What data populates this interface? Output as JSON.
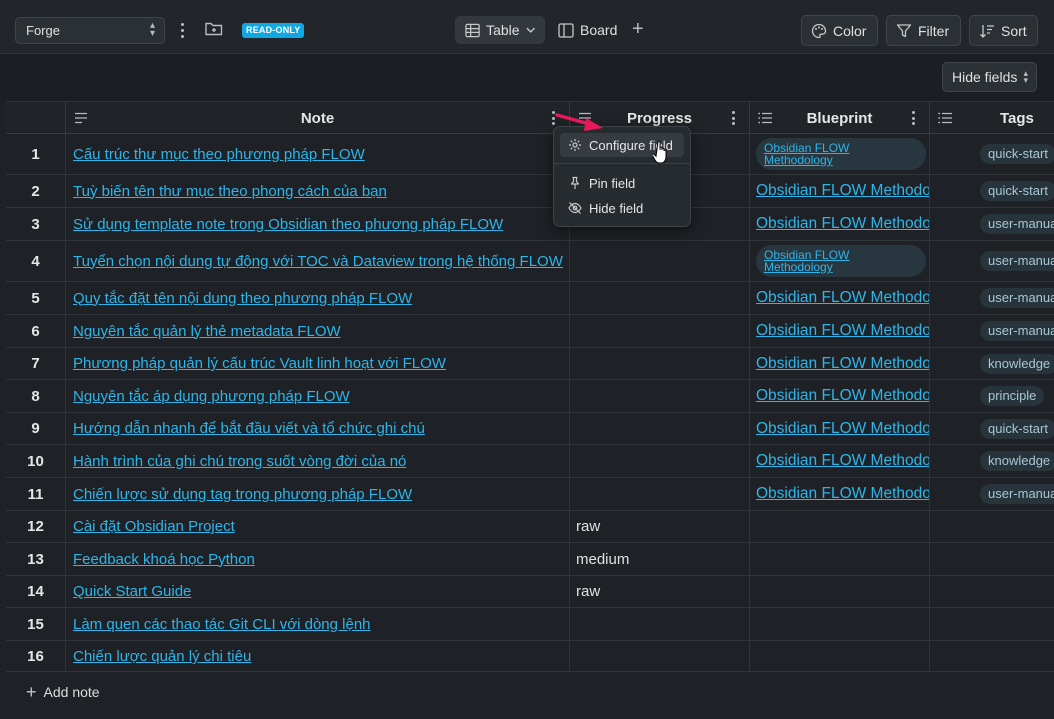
{
  "toolbar": {
    "project_select": "Forge",
    "badge": "READ-ONLY",
    "views": [
      {
        "label": "Table",
        "icon": "table-icon",
        "active": true
      },
      {
        "label": "Board",
        "icon": "board-icon",
        "active": false
      }
    ],
    "color_label": "Color",
    "filter_label": "Filter",
    "sort_label": "Sort",
    "hide_fields_label": "Hide fields"
  },
  "columns": {
    "note": "Note",
    "progress": "Progress",
    "blueprint": "Blueprint",
    "tags": "Tags"
  },
  "context_menu": {
    "items": [
      "Configure field",
      "Pin field",
      "Hide field"
    ]
  },
  "rows": [
    {
      "num": "1",
      "note": "Cấu trúc thư mục theo phương pháp FLOW",
      "progress": "",
      "blueprint": "Obsidian FLOW Methodology",
      "blueprint_chip": true,
      "tag": "quick-start"
    },
    {
      "num": "2",
      "note": "Tuỳ biến tên thư mục theo phong cách của bạn",
      "progress": "",
      "blueprint": "Obsidian FLOW Methodology",
      "blueprint_chip": false,
      "tag": "quick-start"
    },
    {
      "num": "3",
      "note": "Sử dụng template note trong Obsidian theo phương pháp FLOW",
      "progress": "",
      "blueprint": "Obsidian FLOW Methodology",
      "blueprint_chip": false,
      "tag": "user-manual"
    },
    {
      "num": "4",
      "note": "Tuyển chọn nội dung tự động với TOC và Dataview trong hệ thống FLOW",
      "progress": "",
      "blueprint": "Obsidian FLOW Methodology",
      "blueprint_chip": true,
      "tag": "user-manual"
    },
    {
      "num": "5",
      "note": "Quy tắc đặt tên nội dung theo phương pháp FLOW",
      "progress": "",
      "blueprint": "Obsidian FLOW Methodology",
      "blueprint_chip": false,
      "tag": "user-manual"
    },
    {
      "num": "6",
      "note": "Nguyên tắc quản lý thẻ metadata FLOW",
      "progress": "",
      "blueprint": "Obsidian FLOW Methodology",
      "blueprint_chip": false,
      "tag": "user-manual"
    },
    {
      "num": "7",
      "note": "Phương pháp quản lý cấu trúc Vault linh hoạt với FLOW",
      "progress": "",
      "blueprint": "Obsidian FLOW Methodology",
      "blueprint_chip": false,
      "tag": "knowledge"
    },
    {
      "num": "8",
      "note": "Nguyên tắc áp dụng phương pháp FLOW",
      "progress": "",
      "blueprint": "Obsidian FLOW Methodology",
      "blueprint_chip": false,
      "tag": "principle"
    },
    {
      "num": "9",
      "note": "Hướng dẫn nhanh để bắt đầu viết và tổ chức ghi chú",
      "progress": "",
      "blueprint": "Obsidian FLOW Methodology",
      "blueprint_chip": false,
      "tag": "quick-start"
    },
    {
      "num": "10",
      "note": "Hành trình của ghi chú trong suốt vòng đời của nó",
      "progress": "",
      "blueprint": "Obsidian FLOW Methodology",
      "blueprint_chip": false,
      "tag": "knowledge"
    },
    {
      "num": "11",
      "note": "Chiến lược sử dụng tag trong phương pháp FLOW",
      "progress": "",
      "blueprint": "Obsidian FLOW Methodology",
      "blueprint_chip": false,
      "tag": "user-manual"
    },
    {
      "num": "12",
      "note": "Cài đặt Obsidian Project",
      "progress": "raw",
      "blueprint": "",
      "blueprint_chip": false,
      "tag": ""
    },
    {
      "num": "13",
      "note": "Feedback khoá học Python",
      "progress": "medium",
      "blueprint": "",
      "blueprint_chip": false,
      "tag": ""
    },
    {
      "num": "14",
      "note": "Quick Start Guide",
      "progress": "raw",
      "blueprint": "",
      "blueprint_chip": false,
      "tag": ""
    },
    {
      "num": "15",
      "note": "Làm quen các thao tác Git CLI với dòng lệnh",
      "progress": "",
      "blueprint": "",
      "blueprint_chip": false,
      "tag": ""
    },
    {
      "num": "16",
      "note": "Chiến lược quản lý chi tiêu",
      "progress": "",
      "blueprint": "",
      "blueprint_chip": false,
      "tag": ""
    }
  ],
  "add_note_label": "Add note",
  "colors": {
    "link": "#2fb4e9",
    "badge": "#11a7e0",
    "arrow": "#e8185c",
    "background": "#1e2226"
  }
}
